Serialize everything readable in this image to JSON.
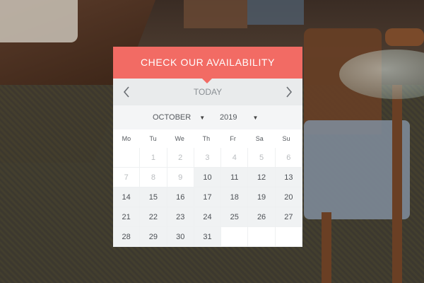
{
  "cta": {
    "label": "CHECK OUR AVAILABILITY"
  },
  "calendar": {
    "nav": {
      "prev_icon": "chevron-left-icon",
      "next_icon": "chevron-right-icon",
      "today_label": "TODAY"
    },
    "month": {
      "selected": "OCTOBER"
    },
    "year": {
      "selected": "2019"
    },
    "weekdays": [
      "Mo",
      "Tu",
      "We",
      "Th",
      "Fr",
      "Sa",
      "Su"
    ],
    "weeks": [
      [
        null,
        "1",
        "2",
        "3",
        "4",
        "5",
        "6"
      ],
      [
        "7",
        "8",
        "9",
        "10",
        "11",
        "12",
        "13"
      ],
      [
        "14",
        "15",
        "16",
        "17",
        "18",
        "19",
        "20"
      ],
      [
        "21",
        "22",
        "23",
        "24",
        "25",
        "26",
        "27"
      ],
      [
        "28",
        "29",
        "30",
        "31",
        null,
        null,
        null
      ]
    ],
    "first_available_day": 10,
    "colors": {
      "accent": "#f26b64",
      "nav_bg": "#e9ebec",
      "available_bg": "#f0f2f3",
      "past_text": "#b9bcbf"
    }
  }
}
